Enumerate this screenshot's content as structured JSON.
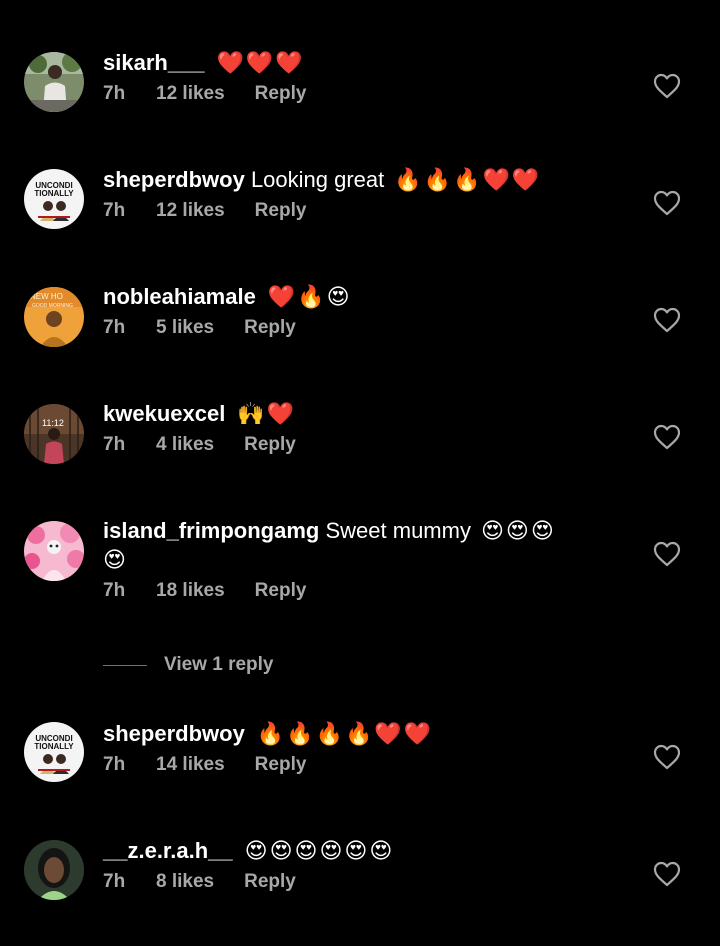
{
  "colors": {
    "background": "#000000",
    "text": "#ffffff",
    "secondary": "#a8a8a8",
    "heart_red": "#ed1c24"
  },
  "comments": [
    {
      "username": "sikarh___",
      "text": "",
      "emojis": "❤️❤️❤️",
      "time": "7h",
      "likes": "12 likes",
      "reply": "Reply",
      "avatar_icon": "person-photo-avatar"
    },
    {
      "username": "sheperdbwoy",
      "text": "Looking great",
      "emojis": "🔥🔥🔥❤️❤️",
      "time": "7h",
      "likes": "12 likes",
      "reply": "Reply",
      "avatar_icon": "unconditionally-logo-avatar",
      "avatar_text": "UNCONDI TIONALLY"
    },
    {
      "username": "nobleahiamale",
      "text": "",
      "emojis": "❤️🔥😍",
      "time": "7h",
      "likes": "5 likes",
      "reply": "Reply",
      "avatar_icon": "orange-photo-avatar",
      "avatar_text": "NEW HO GOOD MORNING"
    },
    {
      "username": "kwekuexcel",
      "text": "",
      "emojis": "🙌❤️",
      "time": "7h",
      "likes": "4 likes",
      "reply": "Reply",
      "avatar_icon": "brown-photo-avatar",
      "avatar_text": "11:12"
    },
    {
      "username": "island_frimpongamg",
      "text": "Sweet mummy",
      "emojis": "😍😍😍",
      "emojis_wrap": "😍",
      "time": "7h",
      "likes": "18 likes",
      "reply": "Reply",
      "avatar_icon": "pink-balloons-avatar"
    },
    {
      "username": "sheperdbwoy",
      "text": "",
      "emojis": "🔥🔥🔥🔥❤️❤️",
      "time": "7h",
      "likes": "14 likes",
      "reply": "Reply",
      "avatar_icon": "unconditionally-logo-avatar",
      "avatar_text": "UNCONDI TIONALLY"
    },
    {
      "username": "__z.e.r.a.h__",
      "text": "",
      "emojis": "😍😍😍😍😍😍",
      "time": "7h",
      "likes": "8 likes",
      "reply": "Reply",
      "avatar_icon": "portrait-photo-avatar"
    }
  ],
  "view_replies": {
    "label": "View 1 reply"
  },
  "icons": {
    "like": "heart-outline-icon"
  }
}
